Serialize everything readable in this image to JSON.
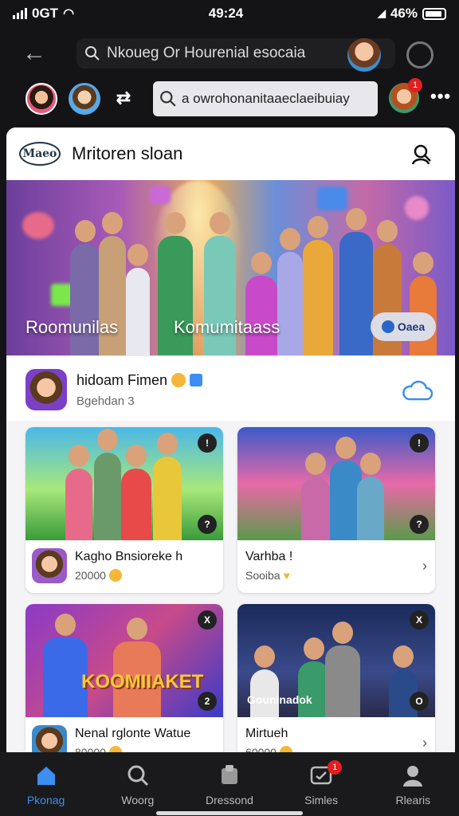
{
  "status_bar": {
    "carrier": "0GT",
    "time": "49:24",
    "battery_pct": "46%"
  },
  "browser": {
    "back_icon": "arrow-left-icon",
    "url_text": "Nkoueg Or Hourenial esocaia",
    "url_icon": "search-icon"
  },
  "app_bar": {
    "search_placeholder": "a owrohonanitaaeclaeibuiay",
    "notification_count": "1"
  },
  "header": {
    "logo_text": "Maeo",
    "title": "Mritoren sloan"
  },
  "banner": {
    "left_label": "Roomunilas",
    "right_label": "Komumitaass",
    "button_label": "Oaea"
  },
  "post": {
    "name": "hidoam Fimen",
    "subtitle": "Bgehdan 3"
  },
  "tiles": [
    {
      "title": "Kagho Bnsioreke h",
      "subtitle": "20000",
      "badge_top": "!",
      "badge_bottom": "?"
    },
    {
      "title": "Varhba !",
      "subtitle": "Sooiba",
      "badge_top": "!",
      "badge_bottom": "?"
    },
    {
      "title": "Nenal rglonte Watue",
      "subtitle": "80000",
      "badge_top": "X",
      "badge_bottom": "2",
      "overlay": "KOOMIIAKET"
    },
    {
      "title": "Mirtueh",
      "subtitle": "60000",
      "badge_top": "X",
      "badge_bottom": "O",
      "overlay": "Gouninadok"
    }
  ],
  "bottom_nav": [
    {
      "label": "Pkonag",
      "icon": "home-icon",
      "active": true
    },
    {
      "label": "Woorg",
      "icon": "search-icon",
      "active": false
    },
    {
      "label": "Dressond",
      "icon": "game-icon",
      "active": false
    },
    {
      "label": "Simles",
      "icon": "message-icon",
      "active": false,
      "badge": "1"
    },
    {
      "label": "Rlearis",
      "icon": "person-icon",
      "active": false
    }
  ],
  "colors": {
    "accent": "#3c8ef0",
    "badge": "#e02020",
    "background": "#141416"
  }
}
